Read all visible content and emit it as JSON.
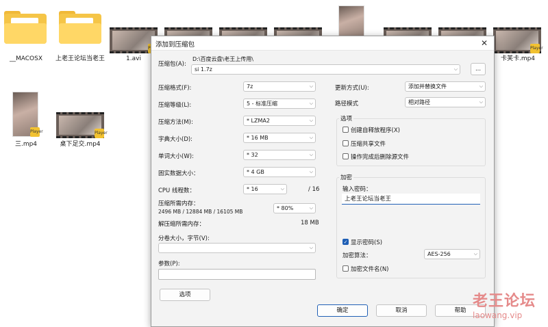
{
  "desktop": {
    "icons": [
      {
        "label": "__MACOSX"
      },
      {
        "label": "上老王论坛当老王"
      },
      {
        "label": "1.avi"
      },
      {
        "label": "卡芙卡.mp4"
      },
      {
        "label": "三.mp4"
      },
      {
        "label": "桌下足交.mp4"
      }
    ],
    "player_badge": "Player"
  },
  "dialog": {
    "title": "添加到压缩包",
    "close_symbol": "✕",
    "archive_label": "压缩包(A):",
    "archive_path": "D:\\百度云盘\\老王上传用\\",
    "archive_name": "si 1.7z",
    "browse_label": "...",
    "format_label": "压缩格式(F):",
    "format_value": "7z",
    "level_label": "压缩等级(L):",
    "level_value": "5 - 标准压缩",
    "method_label": "压缩方法(M):",
    "method_value": "* LZMA2",
    "dict_label": "字典大小(D):",
    "dict_value": "* 16 MB",
    "word_label": "单词大小(W):",
    "word_value": "* 32",
    "solid_label": "固实数据大小：",
    "solid_value": "* 4 GB",
    "threads_label": "CPU 线程数：",
    "threads_value": "* 16",
    "threads_total": "/ 16",
    "mem_comp_label": "压缩所需内存：",
    "mem_comp_detail": "2496 MB / 12884 MB / 16105 MB",
    "mem_comp_value": "* 80%",
    "mem_decomp_label": "解压缩所需内存：",
    "mem_decomp_value": "18 MB",
    "volume_label": "分卷大小，字节(V):",
    "params_label": "参数(P):",
    "options_button": "选项",
    "update_label": "更新方式(U):",
    "update_value": "添加并替换文件",
    "path_label": "路径模式",
    "path_value": "相对路径",
    "options_group": "选项",
    "opt_sfx": "创建自释放程序(X)",
    "opt_shared": "压缩共享文件",
    "opt_delete": "操作完成后删除源文件",
    "enc_group": "加密",
    "enc_input_label": "输入密码：",
    "enc_password": "上老王论坛当老王",
    "show_pwd_label": "显示密码(S)",
    "enc_method_label": "加密算法：",
    "enc_method_value": "AES-256",
    "enc_names_label": "加密文件名(N)",
    "ok": "确定",
    "cancel": "取消",
    "help": "帮助"
  },
  "watermark": {
    "line1": "老王论坛",
    "line2": "laowang.vip"
  }
}
